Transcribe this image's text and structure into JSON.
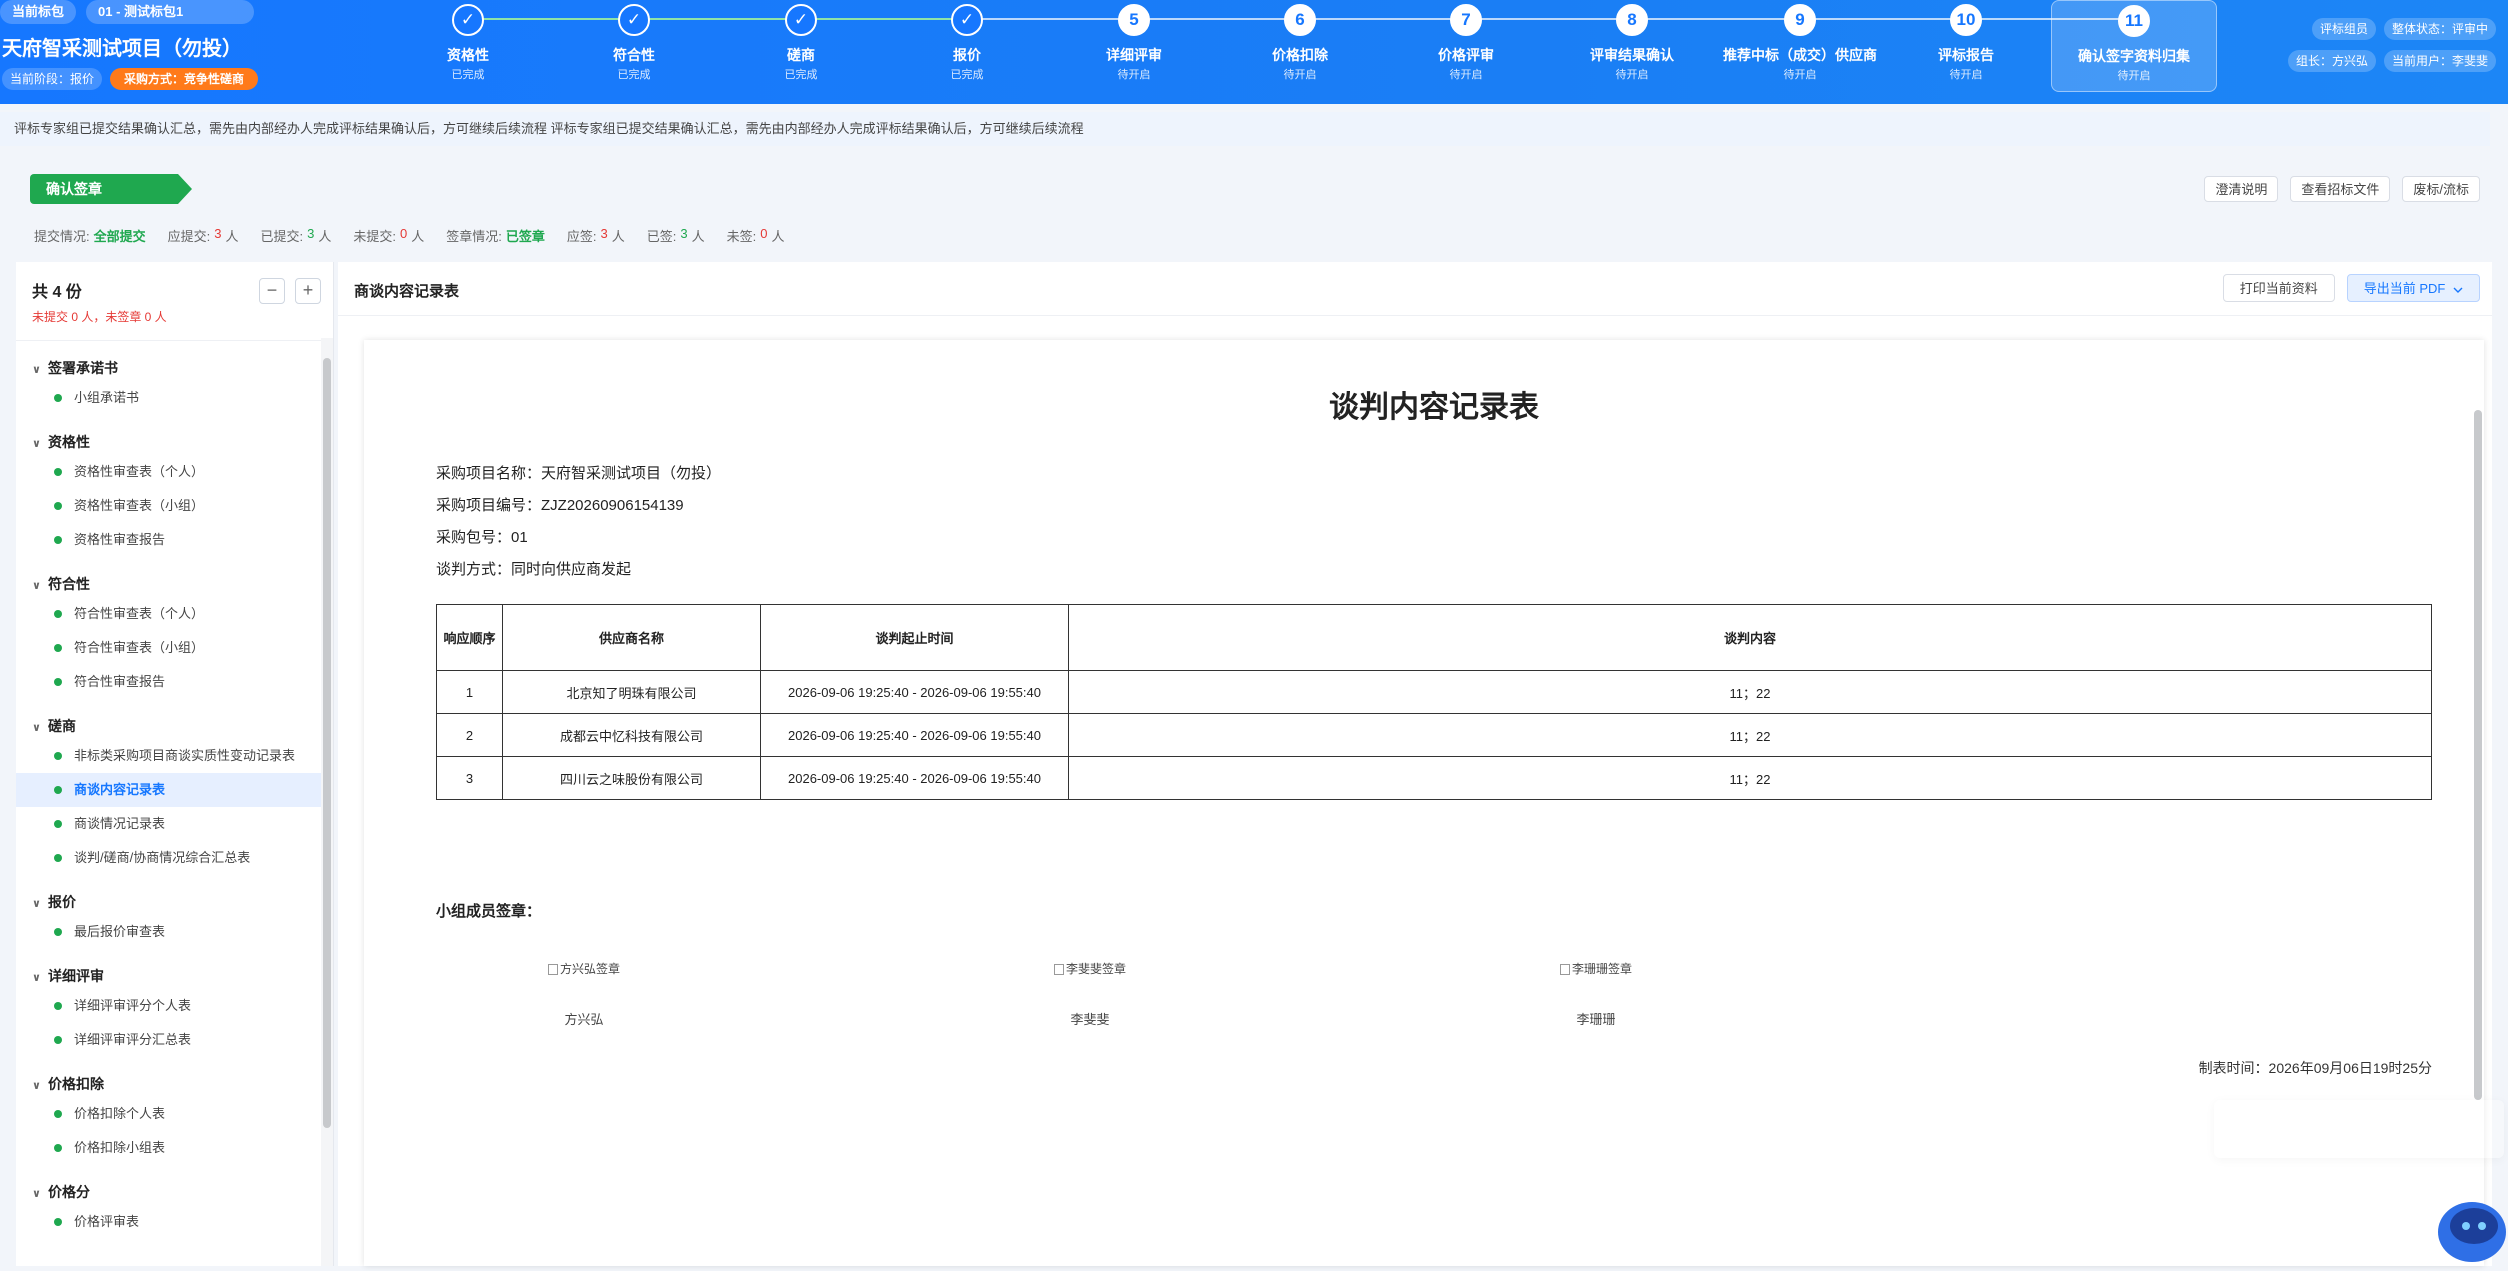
{
  "header": {
    "pkg_label": "当前标包",
    "pkg_name": "01 - 测试标包1",
    "project_title": "天府智采测试项目（勿投）",
    "stage": "当前阶段：报价",
    "method": "采购方式：竞争性磋商",
    "role": "评标组员",
    "overall_status": "整体状态：评审中",
    "leader": "组长：方兴弘",
    "current_user": "当前用户：李斐斐"
  },
  "steps": [
    {
      "num": "✓",
      "label": "资格性",
      "status": "已完成",
      "done": true
    },
    {
      "num": "✓",
      "label": "符合性",
      "status": "已完成",
      "done": true
    },
    {
      "num": "✓",
      "label": "磋商",
      "status": "已完成",
      "done": true
    },
    {
      "num": "✓",
      "label": "报价",
      "status": "已完成",
      "done": true
    },
    {
      "num": "5",
      "label": "详细评审",
      "status": "待开启",
      "done": false
    },
    {
      "num": "6",
      "label": "价格扣除",
      "status": "待开启",
      "done": false
    },
    {
      "num": "7",
      "label": "价格评审",
      "status": "待开启",
      "done": false
    },
    {
      "num": "8",
      "label": "评审结果确认",
      "status": "待开启",
      "done": false
    },
    {
      "num": "9",
      "label": "推荐中标（成交）供应商",
      "status": "待开启",
      "done": false
    },
    {
      "num": "10",
      "label": "评标报告",
      "status": "待开启",
      "done": false
    },
    {
      "num": "11",
      "label": "确认签字资料归集",
      "status": "待开启",
      "done": false,
      "active": true
    }
  ],
  "notice": "评标专家组已提交结果确认汇总，需先由内部经办人完成评标结果确认后，方可继续后续流程 评标专家组已提交结果确认汇总，需先由内部经办人完成评标结果确认后，方可继续后续流程",
  "actions": {
    "confirm_sign": "确认签章",
    "clarify": "澄清说明",
    "view_docs": "查看招标文件",
    "abandon": "废标/流标"
  },
  "stats": {
    "submit_label": "提交情况:",
    "submit_value": "全部提交",
    "should_submit_label": "应提交:",
    "should_submit": "3",
    "submitted_label": "已提交:",
    "submitted": "3",
    "not_submitted_label": "未提交:",
    "not_submitted": "0",
    "sign_label": "签章情况:",
    "sign_value": "已签章",
    "should_sign_label": "应签:",
    "should_sign": "3",
    "signed_label": "已签:",
    "signed": "3",
    "not_signed_label": "未签:",
    "not_signed": "0",
    "unit": "人"
  },
  "sidebar": {
    "total": "共 4 份",
    "sub": "未提交 0 人，未签章 0 人",
    "sections": [
      {
        "title": "签署承诺书",
        "items": [
          "小组承诺书"
        ]
      },
      {
        "title": "资格性",
        "items": [
          "资格性审查表（个人）",
          "资格性审查表（小组）",
          "资格性审查报告"
        ]
      },
      {
        "title": "符合性",
        "items": [
          "符合性审查表（个人）",
          "符合性审查表（小组）",
          "符合性审查报告"
        ]
      },
      {
        "title": "磋商",
        "items": [
          "非标类采购项目商谈实质性变动记录表",
          "商谈内容记录表",
          "商谈情况记录表",
          "谈判/磋商/协商情况综合汇总表"
        ]
      },
      {
        "title": "报价",
        "items": [
          "最后报价审查表"
        ]
      },
      {
        "title": "详细评审",
        "items": [
          "详细评审评分个人表",
          "详细评审评分汇总表"
        ]
      },
      {
        "title": "价格扣除",
        "items": [
          "价格扣除个人表",
          "价格扣除小组表"
        ]
      },
      {
        "title": "价格分",
        "items": [
          "价格评审表"
        ]
      }
    ],
    "selected": "商谈内容记录表"
  },
  "main": {
    "title": "商谈内容记录表",
    "print_btn": "打印当前资料",
    "export_btn": "导出当前 PDF"
  },
  "doc": {
    "title": "谈判内容记录表",
    "project_name": "采购项目名称：天府智采测试项目（勿投）",
    "project_no": "采购项目编号：ZJZ20260906154139",
    "pkg_no": "采购包号：01",
    "method": "谈判方式：同时向供应商发起",
    "columns": [
      "响应顺序",
      "供应商名称",
      "谈判起止时间",
      "谈判内容"
    ],
    "rows": [
      [
        "1",
        "北京知了明珠有限公司",
        "2026-09-06 19:25:40 - 2026-09-06 19:55:40",
        "11；22"
      ],
      [
        "2",
        "成都云中忆科技有限公司",
        "2026-09-06 19:25:40 - 2026-09-06 19:55:40",
        "11；22"
      ],
      [
        "3",
        "四川云之味股份有限公司",
        "2026-09-06 19:25:40 - 2026-09-06 19:55:40",
        "11；22"
      ]
    ],
    "sig_label": "小组成员签章：",
    "signers": [
      {
        "img_alt": "方兴弘签章",
        "name": "方兴弘"
      },
      {
        "img_alt": "李斐斐签章",
        "name": "李斐斐"
      },
      {
        "img_alt": "李珊珊签章",
        "name": "李珊珊"
      }
    ],
    "made_time": "制表时间：2026年09月06日19时25分"
  }
}
